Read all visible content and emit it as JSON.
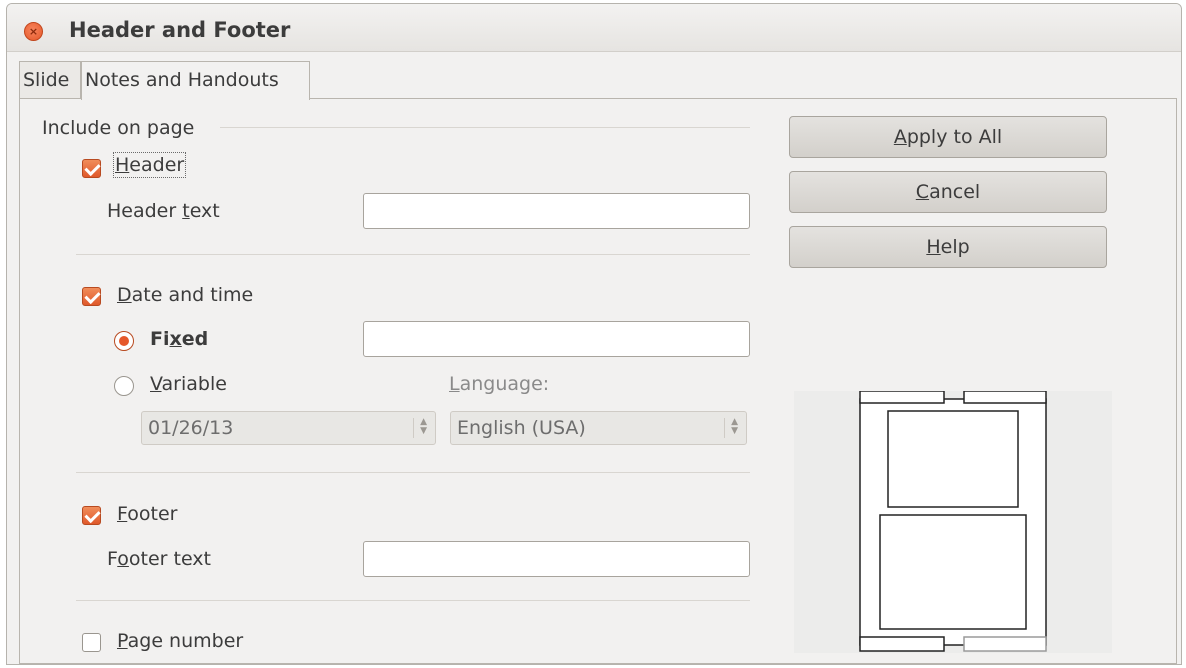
{
  "window": {
    "title": "Header and Footer"
  },
  "tabs": [
    {
      "label": "Slide"
    },
    {
      "label": "Notes and Handouts",
      "active": true
    }
  ],
  "include_on_page": {
    "section_label": "Include on page",
    "header": {
      "checkbox": {
        "before": "",
        "key": "H",
        "after": "eader",
        "checked": true
      },
      "text_label": {
        "before": "Header ",
        "key": "t",
        "after": "ext"
      },
      "text_value": ""
    },
    "date_time": {
      "checkbox": {
        "before": "",
        "key": "D",
        "after": "ate and time",
        "checked": true
      },
      "fixed": {
        "before": "Fi",
        "key": "x",
        "after": "ed",
        "selected": true
      },
      "fixed_value": "",
      "variable": {
        "before": "",
        "key": "V",
        "after": "ariable",
        "selected": false
      },
      "format_value": "01/26/13",
      "language_label": {
        "before": "",
        "key": "L",
        "after": "anguage:"
      },
      "language_value": "English (USA)"
    },
    "footer": {
      "checkbox": {
        "before": "",
        "key": "F",
        "after": "ooter",
        "checked": true
      },
      "text_label": {
        "before": "F",
        "key": "o",
        "after": "oter text"
      },
      "text_value": ""
    },
    "page_number": {
      "checkbox": {
        "before": "",
        "key": "P",
        "after": "age number",
        "checked": false
      }
    }
  },
  "buttons": {
    "apply_to_all": {
      "before": "",
      "key": "A",
      "after": "pply to All"
    },
    "cancel": {
      "before": "",
      "key": "C",
      "after": "ancel"
    },
    "help": {
      "before": "",
      "key": "H",
      "after": "elp"
    }
  },
  "colors": {
    "accent": "#e5582a",
    "window_bg": "#f2f1f0",
    "text": "#3c3c3c"
  }
}
